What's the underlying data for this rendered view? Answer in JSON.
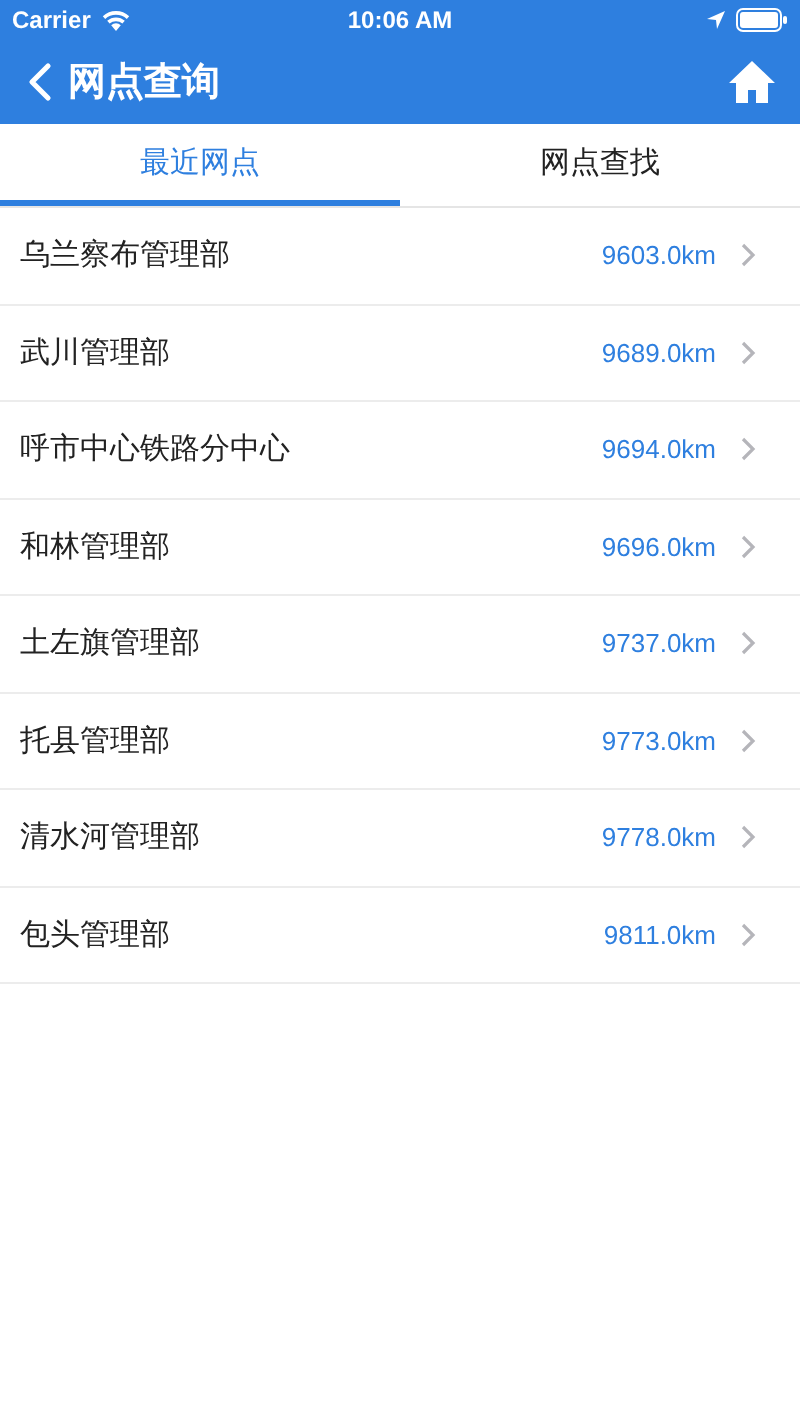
{
  "status_bar": {
    "carrier": "Carrier",
    "time": "10:06 AM"
  },
  "nav": {
    "title": "网点查询"
  },
  "tabs": [
    {
      "label": "最近网点",
      "selected": true
    },
    {
      "label": "网点查找",
      "selected": false
    }
  ],
  "rows": [
    {
      "name": "乌兰察布管理部",
      "distance": "9603.0km"
    },
    {
      "name": "武川管理部",
      "distance": "9689.0km"
    },
    {
      "name": "呼市中心铁路分中心",
      "distance": "9694.0km"
    },
    {
      "name": "和林管理部",
      "distance": "9696.0km"
    },
    {
      "name": "土左旗管理部",
      "distance": "9737.0km"
    },
    {
      "name": "托县管理部",
      "distance": "9773.0km"
    },
    {
      "name": "清水河管理部",
      "distance": "9778.0km"
    },
    {
      "name": "包头管理部",
      "distance": "9811.0km"
    }
  ]
}
